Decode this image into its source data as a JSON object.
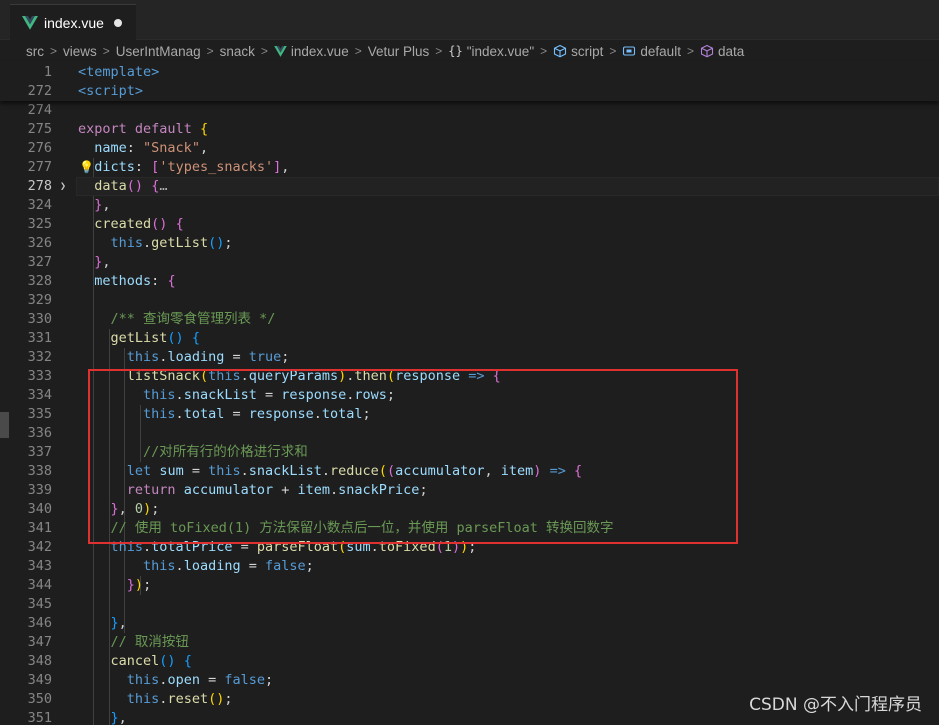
{
  "tab": {
    "label": "index.vue"
  },
  "breadcrumb": {
    "items": [
      "src",
      "views",
      "UserIntManag",
      "snack",
      "index.vue",
      "Vetur Plus",
      "\"index.vue\"",
      "script",
      "default",
      "data"
    ]
  },
  "lines": [
    {
      "num": "1",
      "sticky": true,
      "tokens": [
        [
          "tag",
          "<template>"
        ]
      ]
    },
    {
      "num": "272",
      "sticky": true,
      "tokens": [
        [
          "tag",
          "<script>"
        ]
      ]
    },
    {
      "num": "274",
      "tokens": []
    },
    {
      "num": "275",
      "tokens": [
        [
          "kw",
          "export"
        ],
        [
          "pun",
          " "
        ],
        [
          "kw",
          "default"
        ],
        [
          "pun",
          " "
        ],
        [
          "br1",
          "{"
        ]
      ]
    },
    {
      "num": "276",
      "tokens": [
        [
          "pun",
          "  "
        ],
        [
          "prop",
          "name"
        ],
        [
          "pun",
          ": "
        ],
        [
          "str",
          "\"Snack\""
        ],
        [
          "pun",
          ","
        ]
      ]
    },
    {
      "num": "277",
      "bulb": true,
      "tokens": [
        [
          "pun",
          "  "
        ],
        [
          "prop",
          "dicts"
        ],
        [
          "pun",
          ": "
        ],
        [
          "br2",
          "["
        ],
        [
          "str",
          "'types_snacks'"
        ],
        [
          "br2",
          "]"
        ],
        [
          "pun",
          ","
        ]
      ]
    },
    {
      "num": "278",
      "active": true,
      "fold": true,
      "tokens": [
        [
          "pun",
          "  "
        ],
        [
          "fn",
          "data"
        ],
        [
          "br2",
          "()"
        ],
        [
          "pun",
          " "
        ],
        [
          "br2",
          "{"
        ],
        [
          "ellipsis",
          "…"
        ]
      ]
    },
    {
      "num": "324",
      "tokens": [
        [
          "pun",
          "  "
        ],
        [
          "br2",
          "}"
        ],
        [
          "pun",
          ","
        ]
      ]
    },
    {
      "num": "325",
      "tokens": [
        [
          "pun",
          "  "
        ],
        [
          "fn",
          "created"
        ],
        [
          "br2",
          "()"
        ],
        [
          "pun",
          " "
        ],
        [
          "br2",
          "{"
        ]
      ]
    },
    {
      "num": "326",
      "tokens": [
        [
          "pun",
          "    "
        ],
        [
          "kwb",
          "this"
        ],
        [
          "pun",
          "."
        ],
        [
          "fn",
          "getList"
        ],
        [
          "br3",
          "()"
        ],
        [
          "pun",
          ";"
        ]
      ]
    },
    {
      "num": "327",
      "tokens": [
        [
          "pun",
          "  "
        ],
        [
          "br2",
          "}"
        ],
        [
          "pun",
          ","
        ]
      ]
    },
    {
      "num": "328",
      "tokens": [
        [
          "pun",
          "  "
        ],
        [
          "prop",
          "methods"
        ],
        [
          "pun",
          ": "
        ],
        [
          "br2",
          "{"
        ]
      ]
    },
    {
      "num": "329",
      "tokens": []
    },
    {
      "num": "330",
      "tokens": [
        [
          "pun",
          "    "
        ],
        [
          "cmt",
          "/** 查询零食管理列表 */"
        ]
      ]
    },
    {
      "num": "331",
      "tokens": [
        [
          "pun",
          "    "
        ],
        [
          "fn",
          "getList"
        ],
        [
          "br3",
          "()"
        ],
        [
          "pun",
          " "
        ],
        [
          "br3",
          "{"
        ]
      ]
    },
    {
      "num": "332",
      "tokens": [
        [
          "pun",
          "      "
        ],
        [
          "kwb",
          "this"
        ],
        [
          "pun",
          "."
        ],
        [
          "prop",
          "loading"
        ],
        [
          "pun",
          " = "
        ],
        [
          "kwb",
          "true"
        ],
        [
          "pun",
          ";"
        ]
      ]
    },
    {
      "num": "333",
      "tokens": [
        [
          "pun",
          "      "
        ],
        [
          "fn",
          "listSnack"
        ],
        [
          "br1",
          "("
        ],
        [
          "kwb",
          "this"
        ],
        [
          "pun",
          "."
        ],
        [
          "prop",
          "queryParams"
        ],
        [
          "br1",
          ")"
        ],
        [
          "pun",
          "."
        ],
        [
          "fn",
          "then"
        ],
        [
          "br1",
          "("
        ],
        [
          "param",
          "response"
        ],
        [
          "pun",
          " "
        ],
        [
          "kwb",
          "=>"
        ],
        [
          "pun",
          " "
        ],
        [
          "br2",
          "{"
        ]
      ]
    },
    {
      "num": "334",
      "tokens": [
        [
          "pun",
          "        "
        ],
        [
          "kwb",
          "this"
        ],
        [
          "pun",
          "."
        ],
        [
          "prop",
          "snackList"
        ],
        [
          "pun",
          " = "
        ],
        [
          "param",
          "response"
        ],
        [
          "pun",
          "."
        ],
        [
          "prop",
          "rows"
        ],
        [
          "pun",
          ";"
        ]
      ]
    },
    {
      "num": "335",
      "tokens": [
        [
          "pun",
          "        "
        ],
        [
          "kwb",
          "this"
        ],
        [
          "pun",
          "."
        ],
        [
          "prop",
          "total"
        ],
        [
          "pun",
          " = "
        ],
        [
          "param",
          "response"
        ],
        [
          "pun",
          "."
        ],
        [
          "prop",
          "total"
        ],
        [
          "pun",
          ";"
        ]
      ]
    },
    {
      "num": "336",
      "tokens": []
    },
    {
      "num": "337",
      "tokens": [
        [
          "pun",
          "        "
        ],
        [
          "cmt",
          "//对所有行的价格进行求和"
        ]
      ]
    },
    {
      "num": "338",
      "tokens": [
        [
          "pun",
          "      "
        ],
        [
          "kwb",
          "let"
        ],
        [
          "pun",
          " "
        ],
        [
          "param",
          "sum"
        ],
        [
          "pun",
          " = "
        ],
        [
          "kwb",
          "this"
        ],
        [
          "pun",
          "."
        ],
        [
          "prop",
          "snackList"
        ],
        [
          "pun",
          "."
        ],
        [
          "fn",
          "reduce"
        ],
        [
          "br1",
          "("
        ],
        [
          "br2",
          "("
        ],
        [
          "param",
          "accumulator"
        ],
        [
          "pun",
          ", "
        ],
        [
          "param",
          "item"
        ],
        [
          "br2",
          ")"
        ],
        [
          "pun",
          " "
        ],
        [
          "kwb",
          "=>"
        ],
        [
          "pun",
          " "
        ],
        [
          "br2",
          "{"
        ]
      ]
    },
    {
      "num": "339",
      "tokens": [
        [
          "pun",
          "      "
        ],
        [
          "kw",
          "return"
        ],
        [
          "pun",
          " "
        ],
        [
          "param",
          "accumulator"
        ],
        [
          "pun",
          " + "
        ],
        [
          "param",
          "item"
        ],
        [
          "pun",
          "."
        ],
        [
          "prop",
          "snackPrice"
        ],
        [
          "pun",
          ";"
        ]
      ]
    },
    {
      "num": "340",
      "tokens": [
        [
          "pun",
          "    "
        ],
        [
          "br2",
          "}"
        ],
        [
          "pun",
          ", "
        ],
        [
          "num",
          "0"
        ],
        [
          "br1",
          ")"
        ],
        [
          "pun",
          ";"
        ]
      ]
    },
    {
      "num": "341",
      "tokens": [
        [
          "pun",
          "    "
        ],
        [
          "cmt",
          "// 使用 toFixed(1) 方法保留小数点后一位，并使用 parseFloat 转换回数字"
        ]
      ]
    },
    {
      "num": "342",
      "tokens": [
        [
          "pun",
          "    "
        ],
        [
          "kwb",
          "this"
        ],
        [
          "pun",
          "."
        ],
        [
          "prop",
          "totalPrice"
        ],
        [
          "pun",
          " = "
        ],
        [
          "fn",
          "parseFloat"
        ],
        [
          "br1",
          "("
        ],
        [
          "param",
          "sum"
        ],
        [
          "pun",
          "."
        ],
        [
          "fn",
          "toFixed"
        ],
        [
          "br2",
          "("
        ],
        [
          "num",
          "1"
        ],
        [
          "br2",
          ")"
        ],
        [
          "br1",
          ")"
        ],
        [
          "pun",
          ";"
        ]
      ]
    },
    {
      "num": "343",
      "tokens": [
        [
          "pun",
          "        "
        ],
        [
          "kwb",
          "this"
        ],
        [
          "pun",
          "."
        ],
        [
          "prop",
          "loading"
        ],
        [
          "pun",
          " = "
        ],
        [
          "kwb",
          "false"
        ],
        [
          "pun",
          ";"
        ]
      ]
    },
    {
      "num": "344",
      "tokens": [
        [
          "pun",
          "      "
        ],
        [
          "br2",
          "}"
        ],
        [
          "br1",
          ")"
        ],
        [
          "pun",
          ";"
        ]
      ]
    },
    {
      "num": "345",
      "tokens": []
    },
    {
      "num": "346",
      "tokens": [
        [
          "pun",
          "    "
        ],
        [
          "br3",
          "}"
        ],
        [
          "pun",
          ","
        ]
      ]
    },
    {
      "num": "347",
      "tokens": [
        [
          "pun",
          "    "
        ],
        [
          "cmt",
          "// 取消按钮"
        ]
      ]
    },
    {
      "num": "348",
      "tokens": [
        [
          "pun",
          "    "
        ],
        [
          "fn",
          "cancel"
        ],
        [
          "br3",
          "()"
        ],
        [
          "pun",
          " "
        ],
        [
          "br3",
          "{"
        ]
      ]
    },
    {
      "num": "349",
      "tokens": [
        [
          "pun",
          "      "
        ],
        [
          "kwb",
          "this"
        ],
        [
          "pun",
          "."
        ],
        [
          "prop",
          "open"
        ],
        [
          "pun",
          " = "
        ],
        [
          "kwb",
          "false"
        ],
        [
          "pun",
          ";"
        ]
      ]
    },
    {
      "num": "350",
      "tokens": [
        [
          "pun",
          "      "
        ],
        [
          "kwb",
          "this"
        ],
        [
          "pun",
          "."
        ],
        [
          "fn",
          "reset"
        ],
        [
          "br1",
          "()"
        ],
        [
          "pun",
          ";"
        ]
      ]
    },
    {
      "num": "351",
      "tokens": [
        [
          "pun",
          "    "
        ],
        [
          "br3",
          "}"
        ],
        [
          "pun",
          ","
        ]
      ]
    }
  ],
  "watermark": "CSDN @不入门程序员"
}
